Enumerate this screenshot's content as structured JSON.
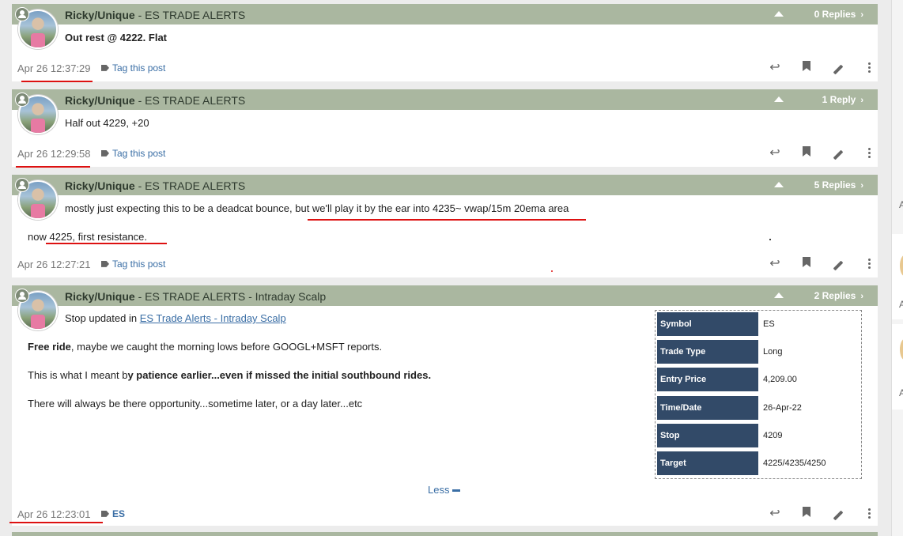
{
  "posts": [
    {
      "author": "Ricky/Unique",
      "title_suffix": " - ES TRADE ALERTS",
      "replies": "0 Replies",
      "body": [
        "Out rest @ 4222. Flat"
      ],
      "timestamp": "Apr 26 12:37:29",
      "tag": "Tag this post"
    },
    {
      "author": "Ricky/Unique",
      "title_suffix": " - ES TRADE ALERTS",
      "replies": "1 Reply",
      "body": [
        "Half out 4229, +20"
      ],
      "timestamp": "Apr 26 12:29:58",
      "tag": "Tag this post"
    },
    {
      "author": "Ricky/Unique",
      "title_suffix": " - ES TRADE ALERTS",
      "replies": "5 Replies",
      "body": [
        "mostly just expecting this to be a deadcat bounce, but we'll play it by the ear into 4235~ vwap/15m 20ema area",
        "now 4225, first resistance."
      ],
      "timestamp": "Apr 26 12:27:21",
      "tag": "Tag this post"
    },
    {
      "author": "Ricky/Unique",
      "title_suffix": " - ES TRADE ALERTS - Intraday Scalp",
      "replies": "2 Replies",
      "stop_prefix": "Stop updated in ",
      "stop_link": "ES Trade Alerts - Intraday Scalp",
      "p1_bold": "Free ride",
      "p1_rest": ", maybe we caught the morning lows before GOOGL+MSFT reports.",
      "p2_a": "This is what I meant b",
      "p2_bold": "y patience earlier...even if missed the initial southbound rides.",
      "p3": "There will always be there opportunity...sometime later, or a day later...etc",
      "less": "Less",
      "timestamp": "Apr 26 12:23:01",
      "tag": "ES"
    }
  ],
  "trade_table": [
    {
      "label": "Symbol",
      "value": "ES"
    },
    {
      "label": "Trade Type",
      "value": "Long"
    },
    {
      "label": "Entry Price",
      "value": "4,209.00"
    },
    {
      "label": "Time/Date",
      "value": "26-Apr-22"
    },
    {
      "label": "Stop",
      "value": "4209"
    },
    {
      "label": "Target",
      "value": "4225/4235/4250"
    }
  ],
  "right_strip_letter": "A",
  "colors": {
    "header": "#aab7a0",
    "table_label": "#324a68",
    "link": "#3a6ea5",
    "annotation": "#dd1111"
  },
  "icons": [
    "user-badge-icon",
    "collapse-arrow-icon",
    "chevron-right-icon",
    "tag-icon",
    "reply-icon",
    "bookmark-icon",
    "edit-pencil-icon",
    "more-vertical-icon",
    "minus-icon"
  ]
}
